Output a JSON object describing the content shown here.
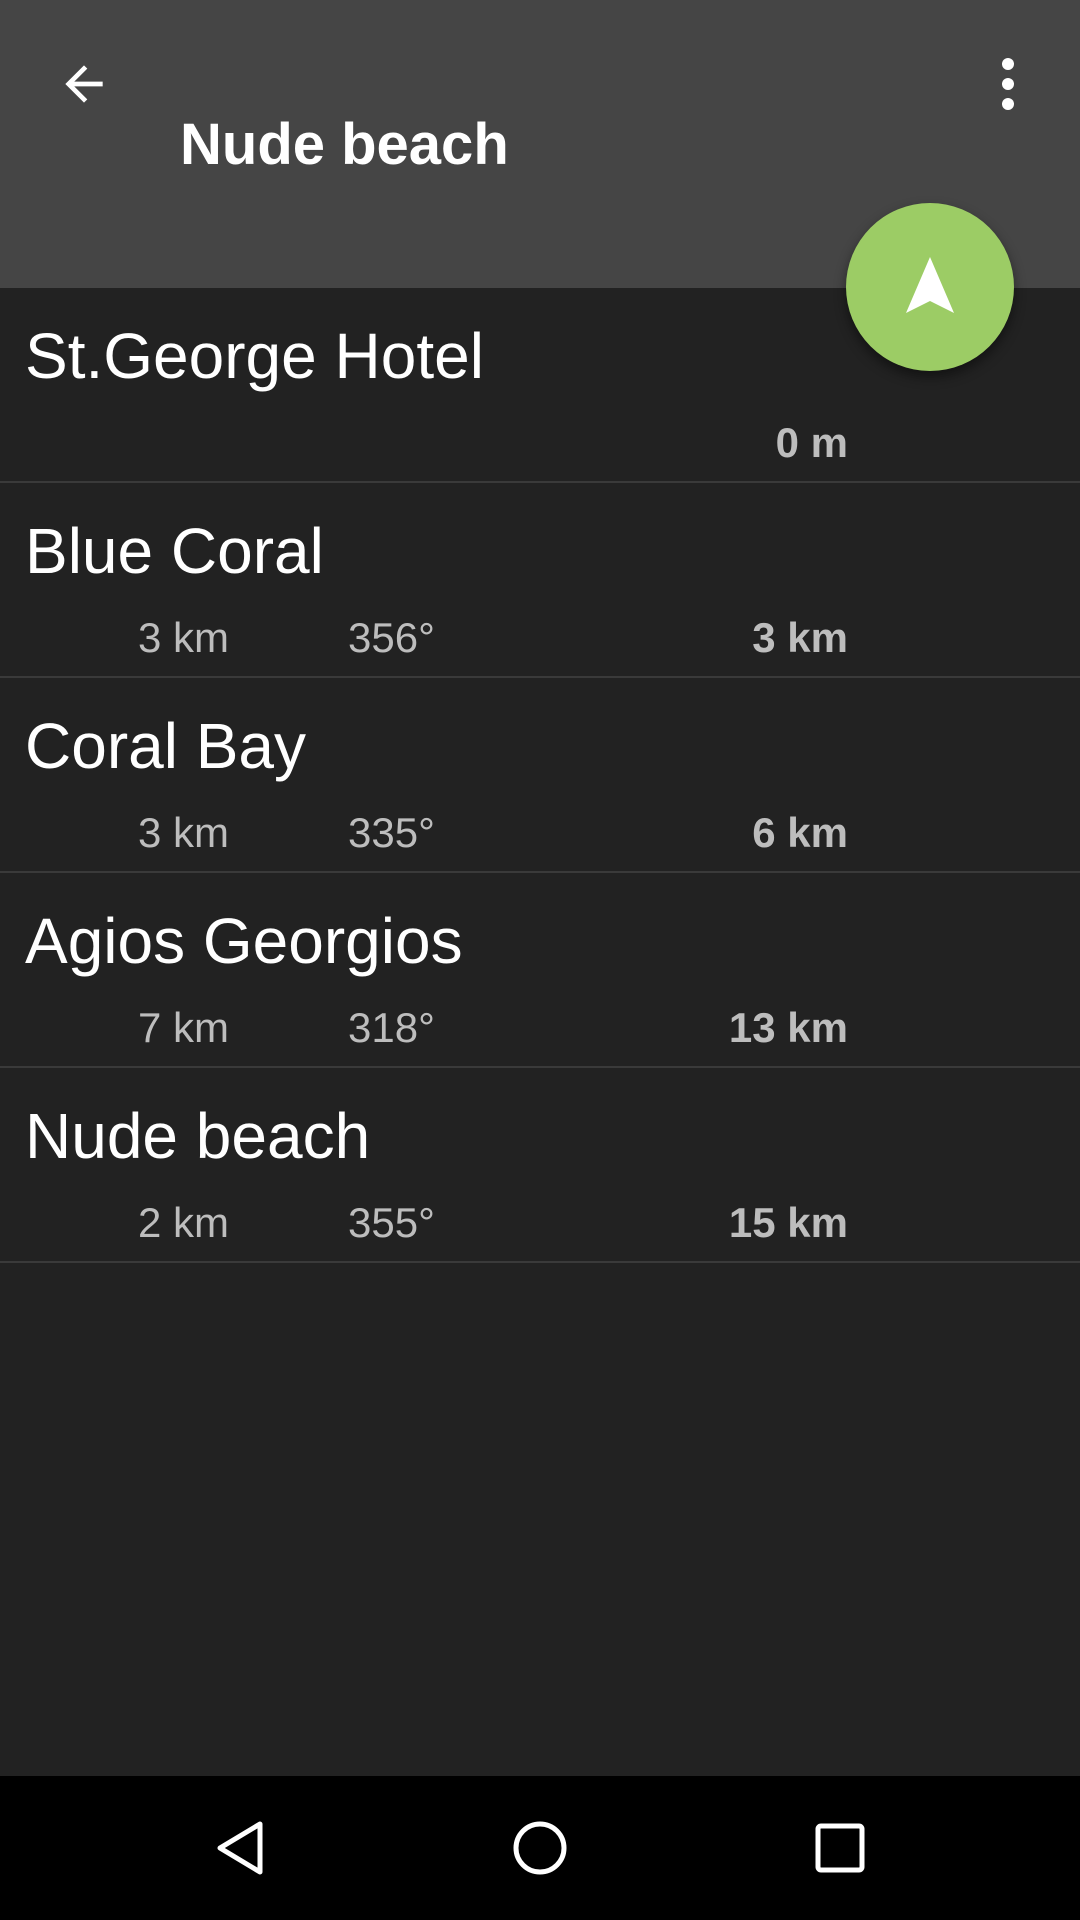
{
  "appbar": {
    "title": "Nude beach",
    "back_icon": "arrow-back-icon",
    "more_icon": "more-vert-icon"
  },
  "fab": {
    "icon": "navigation-arrow-icon",
    "color": "#9CCC65"
  },
  "waypoints": [
    {
      "name": "St.George Hotel",
      "leg_distance": "",
      "bearing": "",
      "total_distance": "0 m"
    },
    {
      "name": "Blue Coral",
      "leg_distance": "3 km",
      "bearing": "356°",
      "total_distance": "3 km"
    },
    {
      "name": "Coral Bay",
      "leg_distance": "3 km",
      "bearing": "335°",
      "total_distance": "6 km"
    },
    {
      "name": "Agios Georgios",
      "leg_distance": "7 km",
      "bearing": "318°",
      "total_distance": "13 km"
    },
    {
      "name": "Nude beach",
      "leg_distance": "2 km",
      "bearing": "355°",
      "total_distance": "15 km"
    }
  ],
  "system_nav": {
    "back_icon": "nav-back-triangle-icon",
    "home_icon": "nav-home-circle-icon",
    "recents_icon": "nav-recents-square-icon"
  },
  "colors": {
    "appbar_bg": "#454545",
    "list_bg": "#222222",
    "accent": "#9CCC65"
  }
}
